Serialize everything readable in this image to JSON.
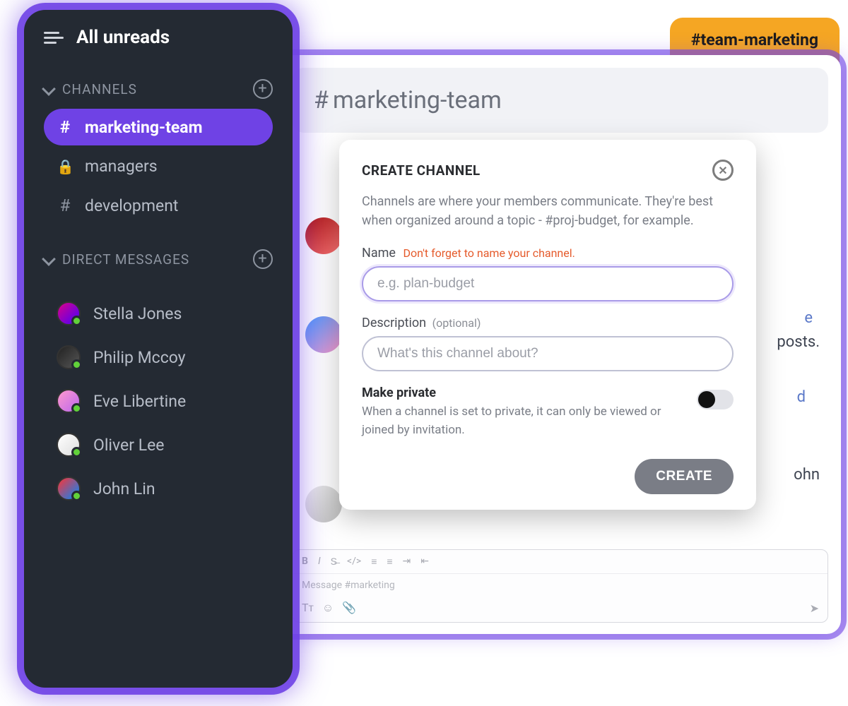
{
  "tag": {
    "label": "#team-marketing"
  },
  "sidebar": {
    "title": "All unreads",
    "channels_header": "CHANNELS",
    "dm_header": "DIRECT MESSAGES",
    "channels": [
      {
        "name": "marketing-team",
        "icon": "hash",
        "active": true
      },
      {
        "name": "managers",
        "icon": "lock",
        "active": false
      },
      {
        "name": "development",
        "icon": "hash",
        "active": false
      }
    ],
    "dms": [
      {
        "name": "Stella Jones"
      },
      {
        "name": "Philip Mccoy"
      },
      {
        "name": "Eve Libertine"
      },
      {
        "name": "Oliver Lee"
      },
      {
        "name": "John Lin"
      }
    ]
  },
  "chat": {
    "header": "marketing-team",
    "bg_snippets": {
      "s1_a": "e",
      "s1_b": "posts.",
      "s2": "d",
      "s3": "ohn"
    },
    "composer": {
      "placeholder": "Message #marketing"
    }
  },
  "modal": {
    "title": "CREATE CHANNEL",
    "description": "Channels are where your members communicate. They're best when organized around a topic - #proj-budget, for example.",
    "name_label": "Name",
    "name_hint": "Don't forget to name your channel.",
    "name_placeholder": "e.g. plan-budget",
    "desc_label": "Description",
    "desc_sub": "(optional)",
    "desc_placeholder": "What's this channel about?",
    "private_title": "Make private",
    "private_desc": "When a channel is set to private, it can only be viewed or joined by invitation.",
    "create_btn": "CREATE"
  }
}
